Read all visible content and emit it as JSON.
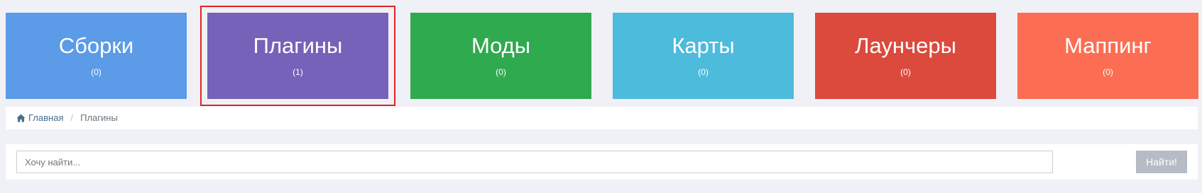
{
  "tiles": [
    {
      "title": "Сборки",
      "count": "(0)",
      "color": "#5b9be8"
    },
    {
      "title": "Плагины",
      "count": "(1)",
      "color": "#7662b8",
      "selected": true
    },
    {
      "title": "Моды",
      "count": "(0)",
      "color": "#30aa4f"
    },
    {
      "title": "Карты",
      "count": "(0)",
      "color": "#4dbbdc"
    },
    {
      "title": "Лаунчеры",
      "count": "(0)",
      "color": "#db4a3c"
    },
    {
      "title": "Маппинг",
      "count": "(0)",
      "color": "#fb6e54"
    }
  ],
  "breadcrumb": {
    "home_label": "Главная",
    "separator": "/",
    "current": "Плагины"
  },
  "search": {
    "placeholder": "Хочу найти...",
    "value": "",
    "button_label": "Найти!"
  }
}
